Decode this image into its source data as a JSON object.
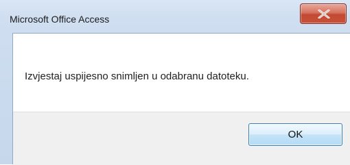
{
  "window": {
    "title": "Microsoft Office Access"
  },
  "dialog": {
    "message": "Izvjestaj uspijesno snimljen u odabranu datoteku.",
    "ok_label": "OK"
  },
  "icons": {
    "close": "close-icon"
  },
  "colors": {
    "close_button": "#c94f37",
    "ok_button_border": "#3c7fb1",
    "frame": "#cfdef0"
  }
}
